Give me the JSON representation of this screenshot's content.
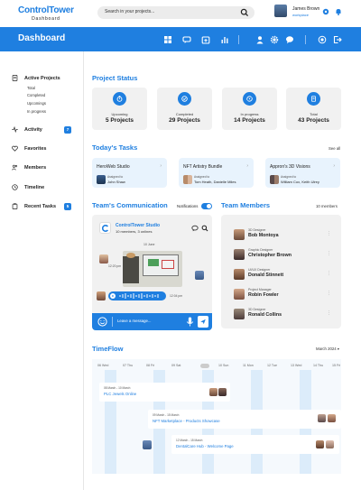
{
  "app": {
    "name": "ControlTower",
    "subtitle": "Dashboard"
  },
  "search": {
    "placeholder": "Search in your projects..."
  },
  "user": {
    "name": "James Brown",
    "workspace": "workplace"
  },
  "header": {
    "title": "Dashboard"
  },
  "sidebar": {
    "items": [
      {
        "label": "Active Projects",
        "badge": ""
      },
      {
        "label": "Activity",
        "badge": "7"
      },
      {
        "label": "Favorites",
        "badge": ""
      },
      {
        "label": "Members",
        "badge": ""
      },
      {
        "label": "Timeline",
        "badge": ""
      },
      {
        "label": "Recent Tasks",
        "badge": "5"
      }
    ],
    "subitems": [
      "Total",
      "Completed",
      "Upcomings",
      "In progress"
    ]
  },
  "project_status": {
    "title": "Project Status",
    "cards": [
      {
        "label": "Upcoming",
        "value": "5 Projects"
      },
      {
        "label": "Completed",
        "value": "29 Projects"
      },
      {
        "label": "In progress",
        "value": "14 Projects"
      },
      {
        "label": "Total",
        "value": "43 Projects"
      }
    ]
  },
  "tasks": {
    "title": "Today's Tasks",
    "see_all": "See all",
    "assigned_label": "Assigned to",
    "items": [
      {
        "name": "HeroWeb Studio",
        "assignees": "John Shaw"
      },
      {
        "name": "NFT Artistry Bundle",
        "assignees": "Tom Heath, Danielle Miles"
      },
      {
        "name": "Appron's 3D Visions",
        "assignees": "William Cox, Keith Ulrey"
      }
    ]
  },
  "communication": {
    "title": "Team's Communication",
    "notifications_label": "Notifications",
    "group_name": "ControlTower Studio",
    "group_meta": "10 members, 3 onlines",
    "date_label": "10 June",
    "msg_time_1": "12:20 pm",
    "msg_time_2": "12:02 pm",
    "voice_time": "12:04 pm",
    "input_placeholder": "Leave a message..."
  },
  "team": {
    "title": "Team Members",
    "count": "10 members",
    "members": [
      {
        "role": "3D Designer",
        "name": "Bob Montoya"
      },
      {
        "role": "Graphic Designer",
        "name": "Christopher Brown"
      },
      {
        "role": "UI/UX Designer",
        "name": "Donald Stinnett"
      },
      {
        "role": "Project Manager",
        "name": "Robin Fowler"
      },
      {
        "role": "3D Designer",
        "name": "Ronald Collins"
      }
    ]
  },
  "timeflow": {
    "title": "TimeFlow",
    "month": "March 2024",
    "days": [
      "06 Wed",
      "07 Thu",
      "08 Fri",
      "09 Sat",
      "10 Sun",
      "11 Mon",
      "12 Tue",
      "13 Wed",
      "14 Thu",
      "15 Fri"
    ],
    "events": [
      {
        "date": "08 March - 10 March",
        "title": "PLC Jewels Online"
      },
      {
        "date": "09 March - 15 March",
        "title": "NFT Marketplace - Products Showcase"
      },
      {
        "date": "12 March - 15 March",
        "title": "DentalCare Hub - Welcome Page"
      }
    ]
  },
  "colors": {
    "accent": "#1f7fe0",
    "card_bg": "#f1f1f1",
    "task_bg": "#e8f3fd"
  }
}
